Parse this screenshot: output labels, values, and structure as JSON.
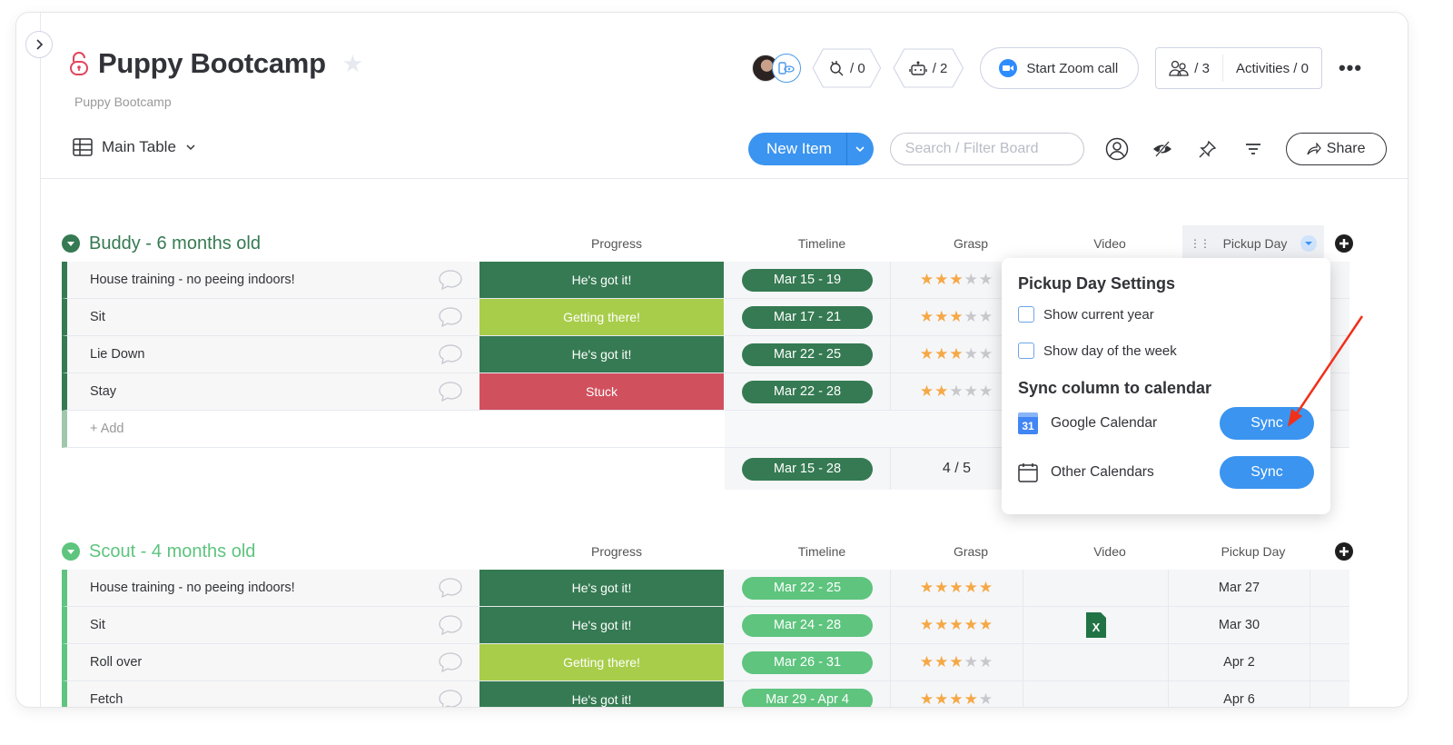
{
  "header": {
    "title": "Puppy Bootcamp",
    "description": "Puppy Bootcamp",
    "integrations_count": "/ 0",
    "automations_count": "/ 2",
    "zoom_label": "Start Zoom call",
    "members_count": "/ 3",
    "activities_label": "Activities / 0"
  },
  "toolbar": {
    "view_label": "Main Table",
    "new_item_label": "New Item",
    "search_placeholder": "Search / Filter Board",
    "share_label": "Share"
  },
  "columns": {
    "progress": "Progress",
    "timeline": "Timeline",
    "grasp": "Grasp",
    "video": "Video",
    "pickup": "Pickup Day"
  },
  "colors": {
    "dark_green": "#357a52",
    "light_green": "#5ec47e",
    "lime": "#a8cd4a",
    "red": "#d1505e",
    "blue": "#3a94f0",
    "star": "#f5a845"
  },
  "groups": [
    {
      "title": "Buddy - 6 months old",
      "color": "#357a52",
      "add_label": "+ Add",
      "summary": {
        "timeline": "Mar 15 - 28",
        "grasp": "4 / 5"
      },
      "rows": [
        {
          "name": "House training - no peeing indoors!",
          "status": "He's got it!",
          "status_color": "#357a52",
          "timeline": "Mar 15 - 19",
          "grasp": 3,
          "video": "",
          "pickup": ""
        },
        {
          "name": "Sit",
          "status": "Getting there!",
          "status_color": "#a8cd4a",
          "timeline": "Mar 17 - 21",
          "grasp": 3,
          "video": "",
          "pickup": ""
        },
        {
          "name": "Lie Down",
          "status": "He's got it!",
          "status_color": "#357a52",
          "timeline": "Mar 22 - 25",
          "grasp": 3,
          "video": "",
          "pickup": ""
        },
        {
          "name": "Stay",
          "status": "Stuck",
          "status_color": "#d1505e",
          "timeline": "Mar 22 - 28",
          "grasp": 2,
          "video": "",
          "pickup": ""
        }
      ]
    },
    {
      "title": "Scout - 4 months old",
      "color": "#5ec47e",
      "rows": [
        {
          "name": "House training - no peeing indoors!",
          "status": "He's got it!",
          "status_color": "#357a52",
          "timeline": "Mar 22 - 25",
          "grasp": 5,
          "video": "",
          "pickup": "Mar 27"
        },
        {
          "name": "Sit",
          "status": "He's got it!",
          "status_color": "#357a52",
          "timeline": "Mar 24 - 28",
          "grasp": 5,
          "video": "excel-file",
          "pickup": "Mar 30"
        },
        {
          "name": "Roll over",
          "status": "Getting there!",
          "status_color": "#a8cd4a",
          "timeline": "Mar 26 - 31",
          "grasp": 3,
          "video": "",
          "pickup": "Apr 2"
        },
        {
          "name": "Fetch",
          "status": "He's got it!",
          "status_color": "#357a52",
          "timeline": "Mar 29 - Apr 4",
          "grasp": 4,
          "video": "",
          "pickup": "Apr 6"
        }
      ]
    }
  ],
  "popup": {
    "title": "Pickup Day Settings",
    "show_year": "Show current year",
    "show_weekday": "Show day of the week",
    "sync_title": "Sync column to calendar",
    "google_label": "Google Calendar",
    "google_day": "31",
    "other_label": "Other Calendars",
    "sync_label": "Sync"
  }
}
